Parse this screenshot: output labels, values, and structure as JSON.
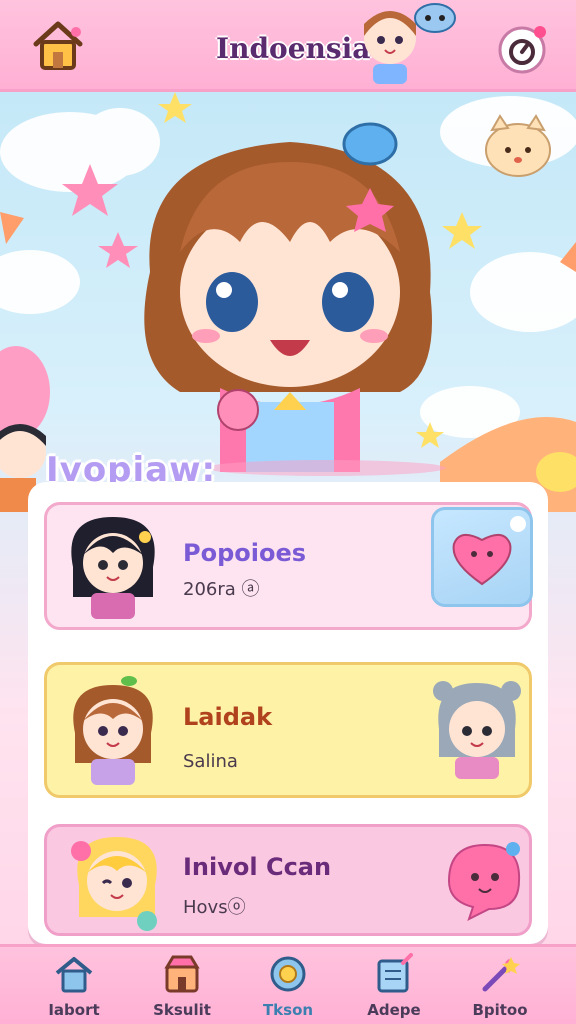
{
  "header": {
    "title": "Indoensia",
    "home_icon": "home-icon",
    "settings_icon": "settings-icon"
  },
  "hero": {
    "label": "Ivopiaw:"
  },
  "cards": [
    {
      "title": "Popoioes",
      "subtitle": "206ra ⓐ",
      "title_color": "#7b5ad6",
      "action_icon": "heart-icon"
    },
    {
      "title": "Laidak",
      "subtitle": "Salina",
      "title_color": "#b0421e"
    },
    {
      "title": "Inivol Ccan",
      "subtitle": "Hovsⓞ",
      "title_color": "#6a2c7a"
    }
  ],
  "nav": {
    "items": [
      {
        "label": "Iabort",
        "icon": "home-icon"
      },
      {
        "label": "Sksulit",
        "icon": "shop-icon"
      },
      {
        "label": "Tkson",
        "icon": "sun-icon",
        "active": true
      },
      {
        "label": "Adepe",
        "icon": "map-icon"
      },
      {
        "label": "Bpitoo",
        "icon": "wand-icon"
      }
    ]
  },
  "colors": {
    "header_pink": "#ffb0d4",
    "sky_blue": "#bfe6f7",
    "card_pink": "#fde4f0",
    "card_yellow": "#fdf2a6",
    "accent_blue": "#3b7fb0"
  }
}
